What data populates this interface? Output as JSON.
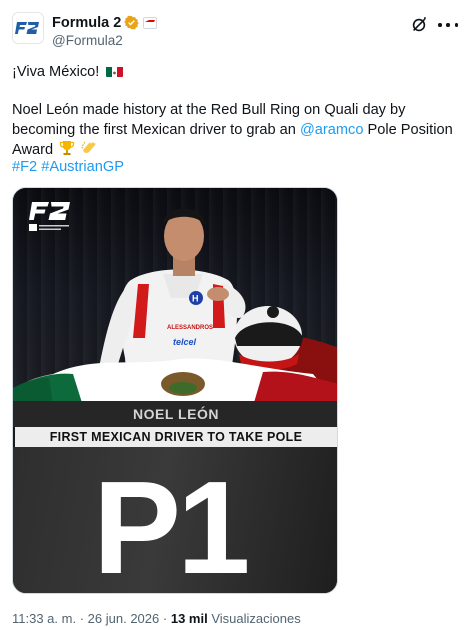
{
  "account": {
    "display_name": "Formula 2",
    "handle": "@Formula2",
    "avatar_icon": "f2-logo-icon",
    "verified_color": "#e8a317"
  },
  "tweet": {
    "line1": "¡Viva México!",
    "line2_prefix": "Noel León made history at the Red Bull Ring on Quali day by becoming the first Mexican driver to grab an ",
    "mention": "@aramco",
    "line2_suffix": " Pole Position Award",
    "hashtag1": "#F2",
    "hashtag2": "#AustrianGP",
    "link_color": "#1d9bf0"
  },
  "media": {
    "driver_name": "NOEL LEÓN",
    "banner_text": "FIRST MEXICAN DRIVER TO TAKE POLE",
    "big_text": "P1",
    "suit_text_1": "ALESSANDROS",
    "suit_text_2": "telcel"
  },
  "meta": {
    "time": "11:33 a. m.",
    "separator": "·",
    "date": "26 jun. 2026",
    "views_count": "13 mil",
    "views_label": "Visualizaciones"
  }
}
